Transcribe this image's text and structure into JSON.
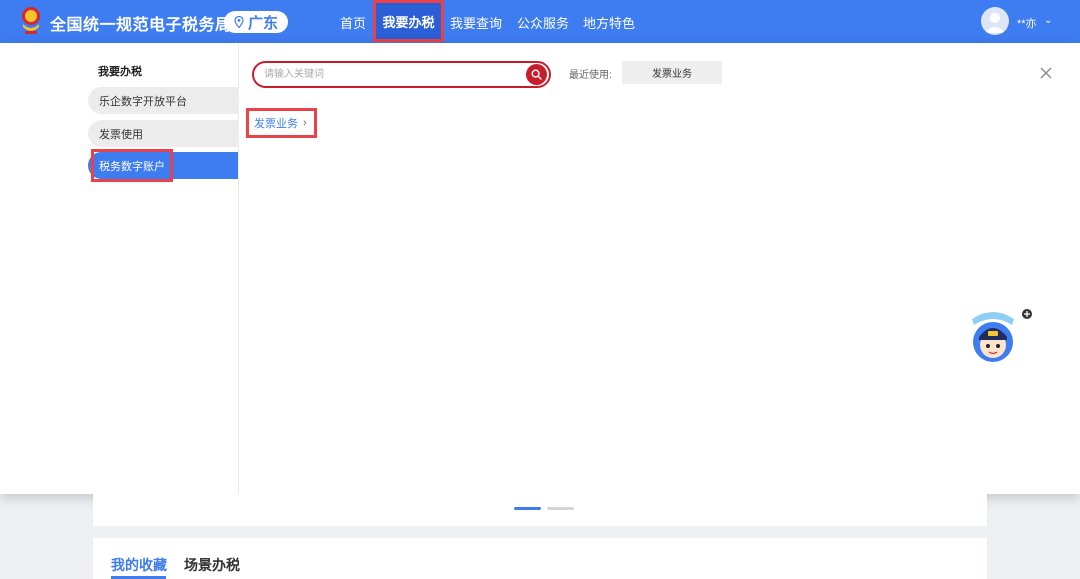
{
  "header": {
    "site_title": "全国统一规范电子税务局",
    "region": "广东",
    "nav": [
      "首页",
      "我要办税",
      "我要查询",
      "公众服务",
      "地方特色"
    ],
    "active_nav": "我要办税",
    "user_name": "**亦"
  },
  "sidebar": {
    "heading": "我要办税",
    "items": [
      {
        "label": "乐企数字开放平台"
      },
      {
        "label": "发票使用"
      },
      {
        "label": "税务数字账户"
      }
    ],
    "active_index": 2
  },
  "search": {
    "placeholder": "请输入关键词"
  },
  "recent": {
    "label": "最近使用:",
    "chip": "发票业务"
  },
  "content": {
    "link": "发票业务"
  },
  "bottom": {
    "tabs": [
      "我的收藏",
      "场景办税"
    ]
  },
  "colors": {
    "header_blue": "#3e7cf1",
    "highlight_red": "#e8424b",
    "search_red": "#c81e2c"
  }
}
